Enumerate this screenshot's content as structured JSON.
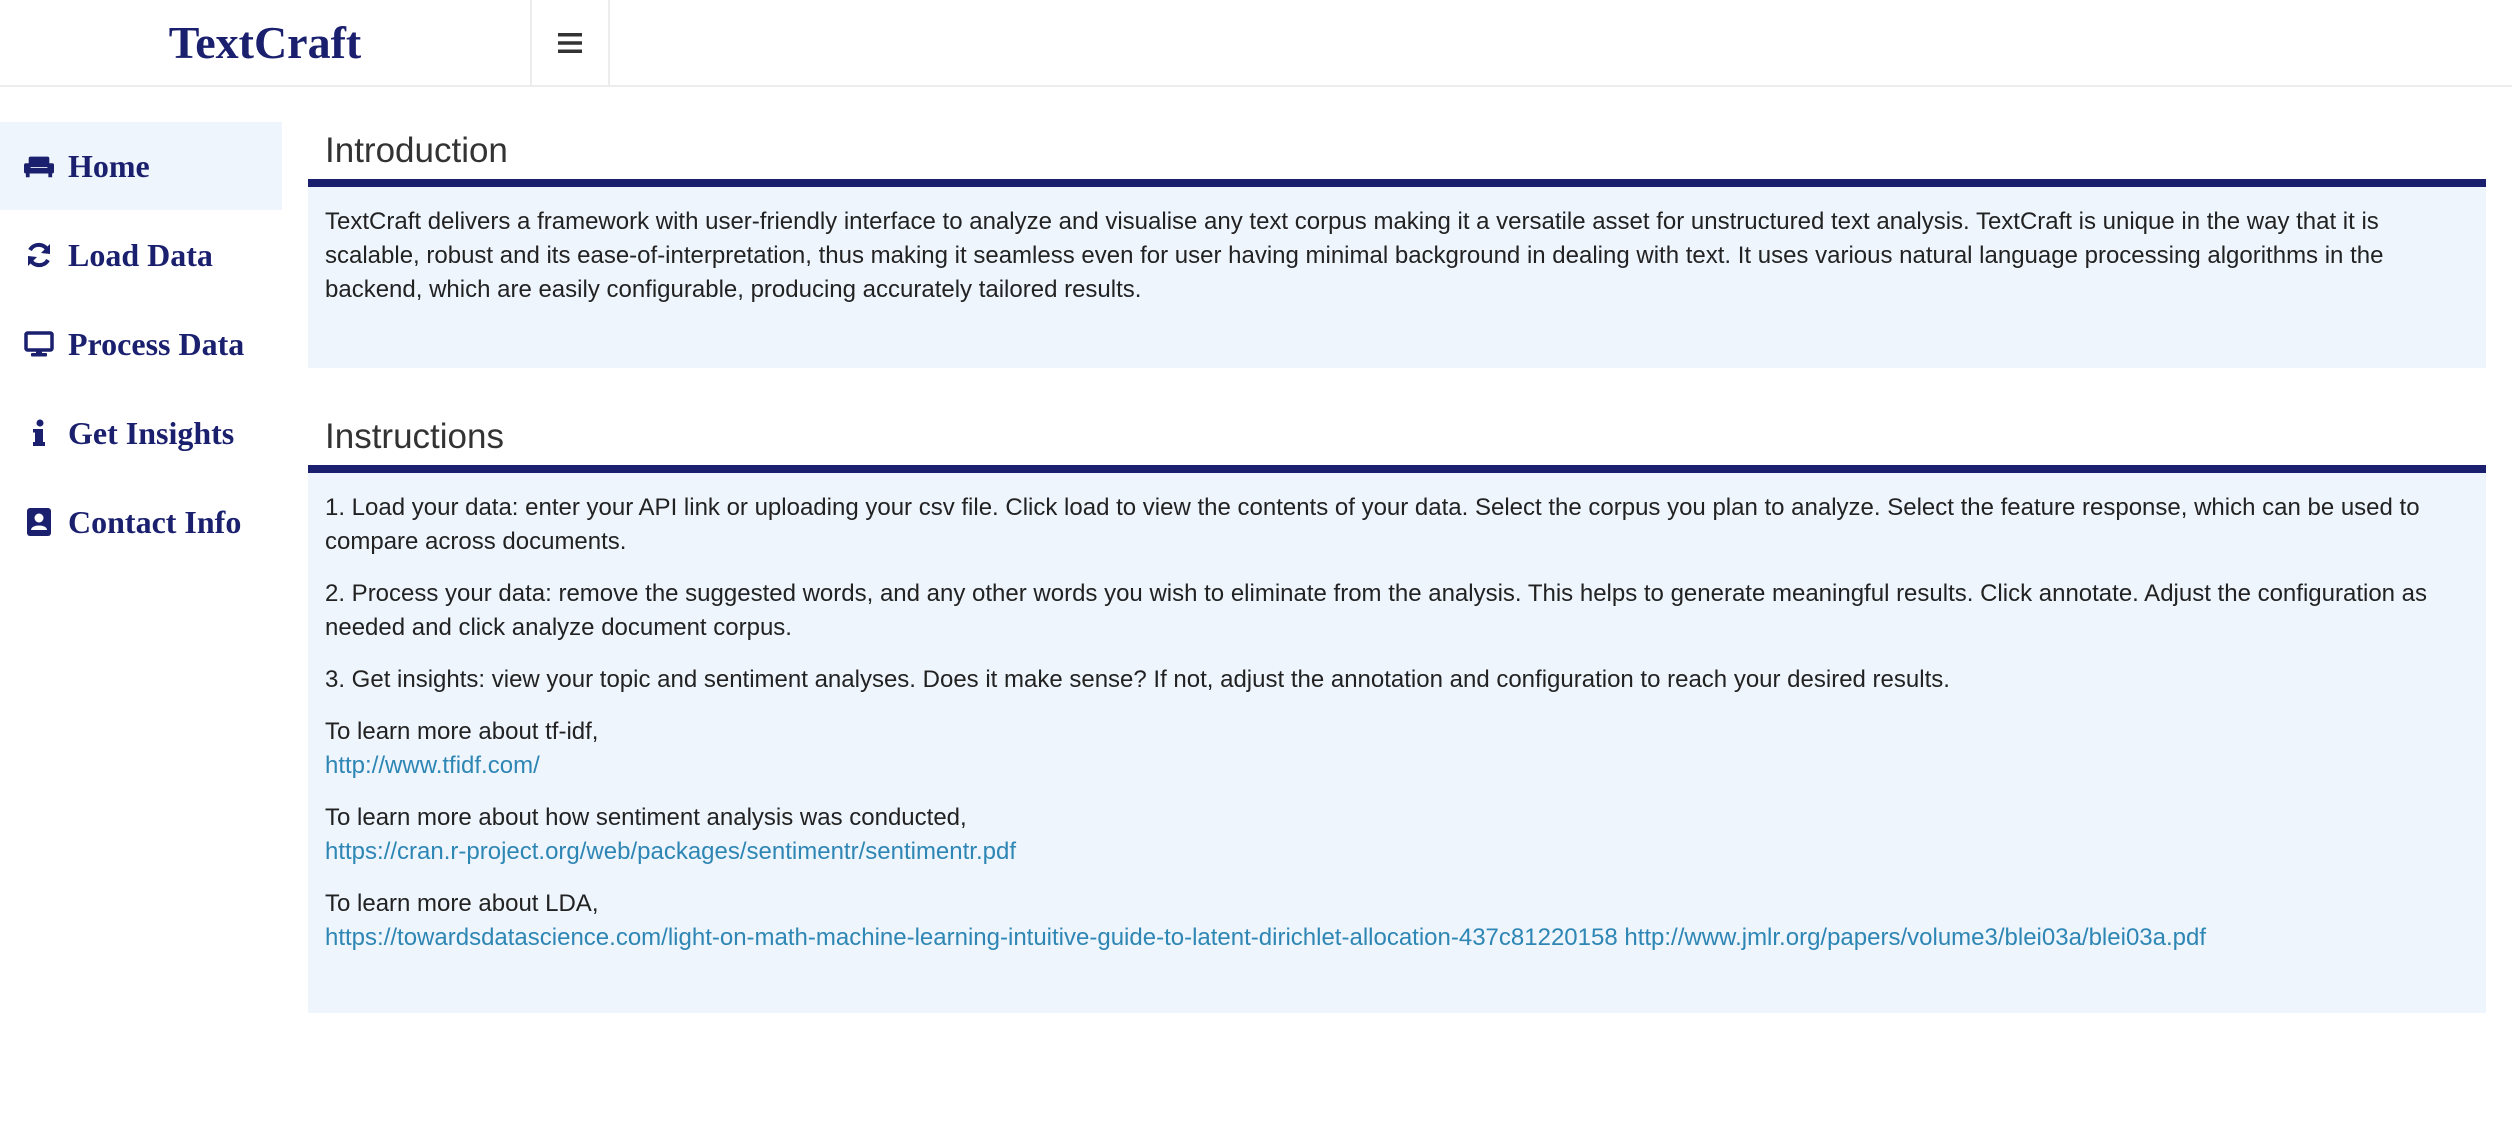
{
  "app": {
    "brand": "TextCraft"
  },
  "sidebar": {
    "items": [
      {
        "label": "Home",
        "icon": "sofa-icon",
        "active": true
      },
      {
        "label": "Load Data",
        "icon": "refresh-icon",
        "active": false
      },
      {
        "label": "Process Data",
        "icon": "desktop-icon",
        "active": false
      },
      {
        "label": "Get Insights",
        "icon": "info-icon",
        "active": false
      },
      {
        "label": "Contact Info",
        "icon": "contact-card-icon",
        "active": false
      }
    ]
  },
  "intro": {
    "title": "Introduction",
    "text": "TextCraft delivers a framework with user-friendly interface to analyze and visualise any text corpus making it a versatile asset for unstructured text analysis. TextCraft is unique in the way that it is scalable, robust and its ease-of-interpretation, thus making it seamless even for user having minimal background in dealing with text. It uses various natural language processing algorithms in the backend, which are easily configurable, producing accurately tailored results."
  },
  "instructions": {
    "title": "Instructions",
    "step1": "1. Load your data: enter your API link or uploading your csv file. Click load to view the contents of your data. Select the corpus you plan to analyze. Select the feature response, which can be used to compare across documents.",
    "step2": "2. Process your data: remove the suggested words, and any other words you wish to eliminate from the analysis. This helps to generate meaningful results. Click annotate. Adjust the configuration as needed and click analyze document corpus.",
    "step3": "3. Get insights: view your topic and sentiment analyses. Does it make sense? If not, adjust the annotation and configuration to reach your desired results.",
    "tfidf_label": "To learn more about tf-idf,",
    "tfidf_link": "http://www.tfidf.com/",
    "sentiment_label": "To learn more about how sentiment analysis was conducted,",
    "sentiment_link": "https://cran.r-project.org/web/packages/sentimentr/sentimentr.pdf",
    "lda_label": "To learn more about LDA,",
    "lda_link1": "https://towardsdatascience.com/light-on-math-machine-learning-intuitive-guide-to-latent-dirichlet-allocation-437c81220158",
    "lda_link2": "http://www.jmlr.org/papers/volume3/blei03a/blei03a.pdf"
  },
  "colors": {
    "brand": "#1a1f6e",
    "panel_bg": "#eef5fd",
    "link": "#2e86b4"
  }
}
